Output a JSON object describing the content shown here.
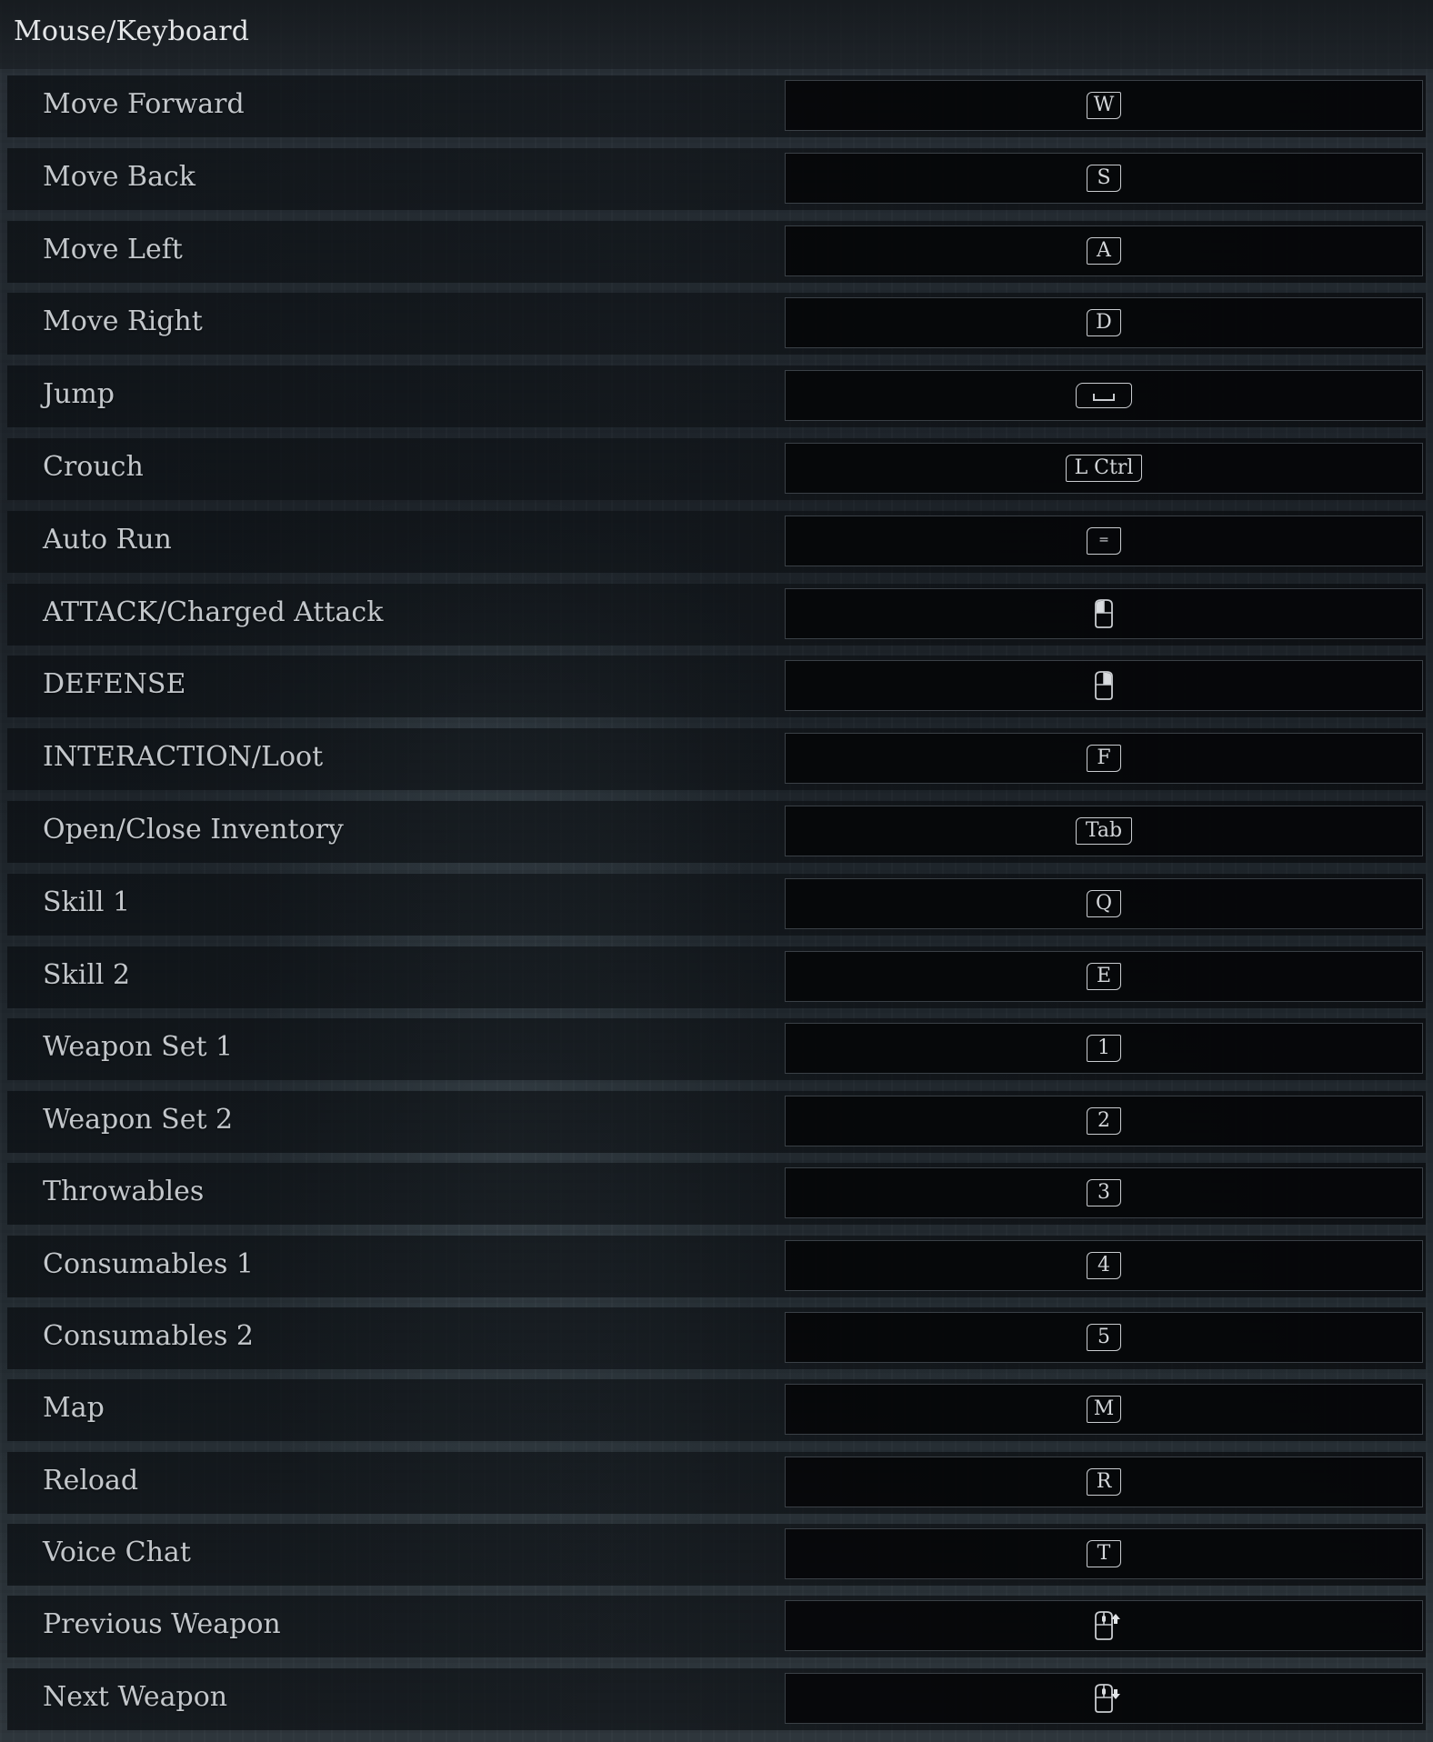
{
  "section_title": "Mouse/Keyboard",
  "bindings": [
    {
      "action": "Move Forward",
      "key": "W",
      "key_type": "key"
    },
    {
      "action": "Move Back",
      "key": "S",
      "key_type": "key"
    },
    {
      "action": "Move Left",
      "key": "A",
      "key_type": "key"
    },
    {
      "action": "Move Right",
      "key": "D",
      "key_type": "key"
    },
    {
      "action": "Jump",
      "key": "",
      "key_type": "space"
    },
    {
      "action": "Crouch",
      "key": "L Ctrl",
      "key_type": "key"
    },
    {
      "action": "Auto Run",
      "key": "=",
      "key_type": "key"
    },
    {
      "action": "ATTACK/Charged Attack",
      "key": "",
      "key_type": "mouse-left-icon"
    },
    {
      "action": "DEFENSE",
      "key": "",
      "key_type": "mouse-right-icon"
    },
    {
      "action": "INTERACTION/Loot",
      "key": "F",
      "key_type": "key"
    },
    {
      "action": "Open/Close Inventory",
      "key": "Tab",
      "key_type": "key"
    },
    {
      "action": "Skill 1",
      "key": "Q",
      "key_type": "key"
    },
    {
      "action": "Skill 2",
      "key": "E",
      "key_type": "key"
    },
    {
      "action": "Weapon Set 1",
      "key": "1",
      "key_type": "key"
    },
    {
      "action": "Weapon Set 2",
      "key": "2",
      "key_type": "key"
    },
    {
      "action": "Throwables",
      "key": "3",
      "key_type": "key"
    },
    {
      "action": "Consumables 1",
      "key": "4",
      "key_type": "key"
    },
    {
      "action": "Consumables 2",
      "key": "5",
      "key_type": "key"
    },
    {
      "action": "Map",
      "key": "M",
      "key_type": "key"
    },
    {
      "action": "Reload",
      "key": "R",
      "key_type": "key"
    },
    {
      "action": "Voice Chat",
      "key": "T",
      "key_type": "key"
    },
    {
      "action": "Previous Weapon",
      "key": "",
      "key_type": "mouse-wheel-up-icon"
    },
    {
      "action": "Next Weapon",
      "key": "",
      "key_type": "mouse-wheel-down-icon"
    }
  ]
}
